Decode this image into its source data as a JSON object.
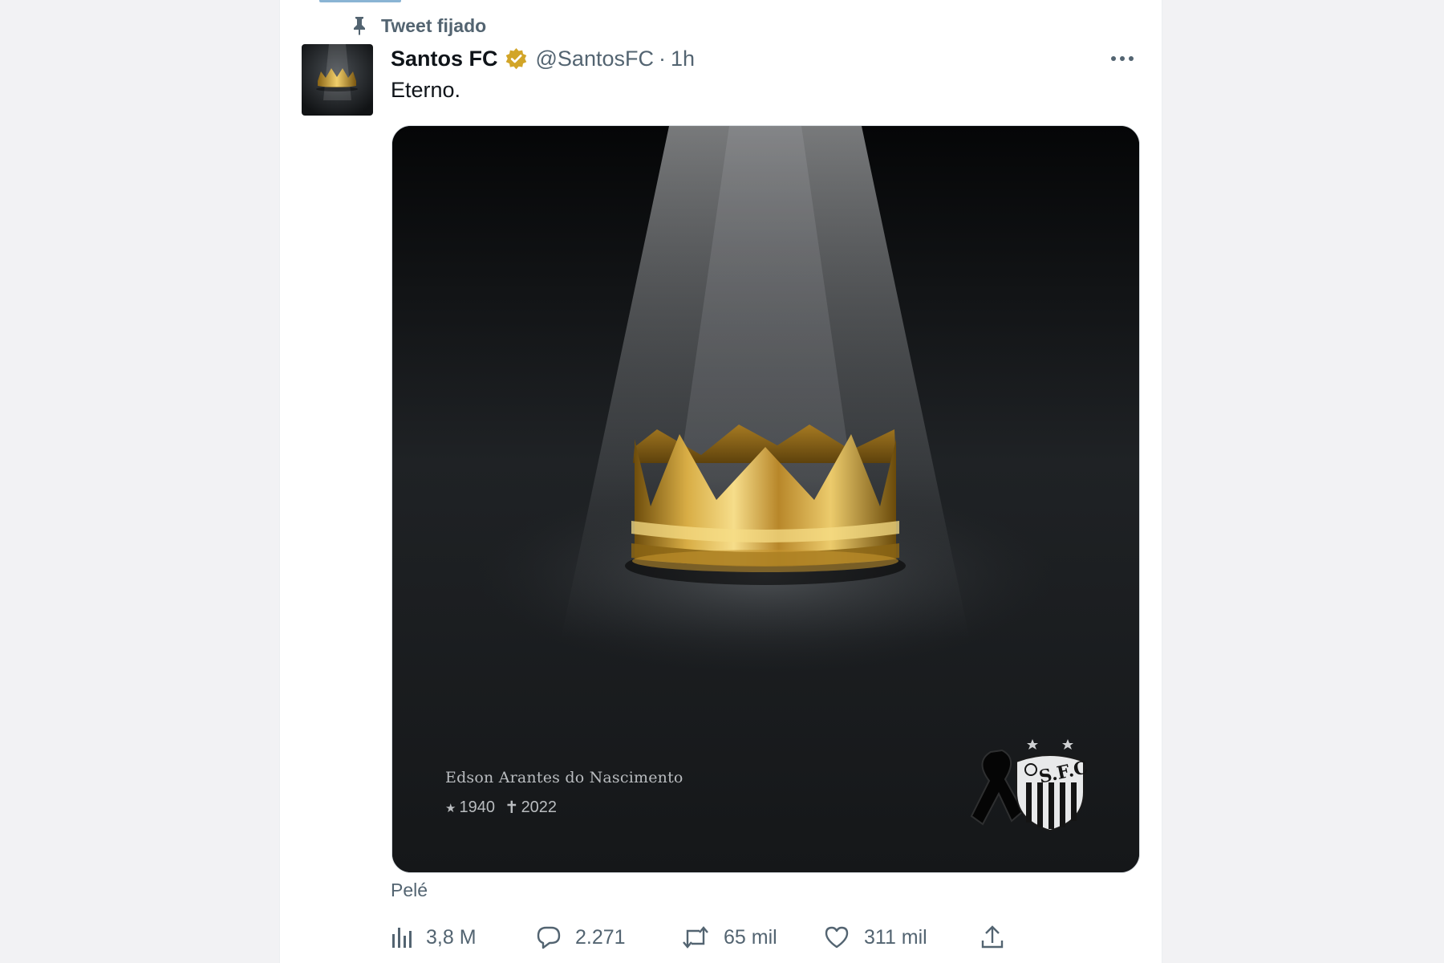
{
  "pinned": {
    "label": "Tweet fijado",
    "icon": "pin-icon"
  },
  "author": {
    "name": "Santos FC",
    "handle": "@SantosFC",
    "separator": "·",
    "time": "1h",
    "verified_icon": "verified-badge-icon",
    "verified_color": "#d2a528"
  },
  "tweet": {
    "text": "Eterno."
  },
  "media": {
    "full_name": "Edson Arantes do Nascimento",
    "birth_glyph": "★",
    "birth_year": "1940",
    "death_glyph": "✝",
    "death_year": "2022",
    "logo_text": "S.F.C.",
    "label": "Pelé"
  },
  "actions": {
    "views": {
      "icon": "views-chart-icon",
      "count": "3,8 M"
    },
    "replies": {
      "icon": "reply-icon",
      "count": "2.271"
    },
    "retweets": {
      "icon": "retweet-icon",
      "count": "65 mil"
    },
    "likes": {
      "icon": "heart-icon",
      "count": "311 mil"
    },
    "share": {
      "icon": "share-icon"
    }
  },
  "colors": {
    "text_primary": "#0f1419",
    "text_secondary": "#536471",
    "gold": "#d4a93a",
    "background": "#f2f2f4"
  }
}
